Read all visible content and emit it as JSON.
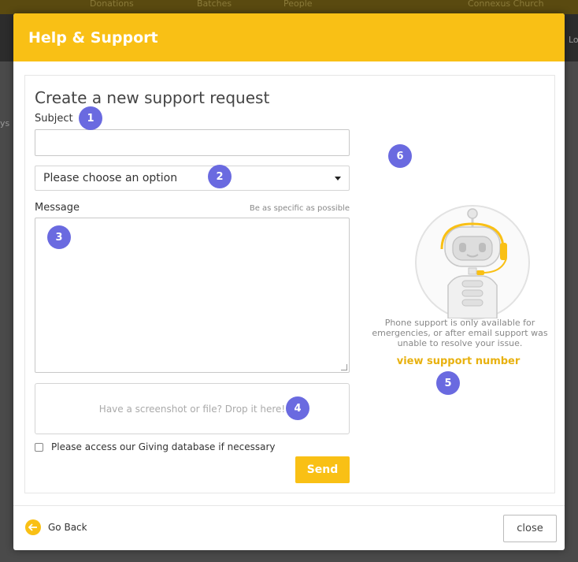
{
  "background": {
    "tabs": [
      "Donations",
      "Batches",
      "People"
    ],
    "account_text": "Connexus Church",
    "side_text_right": "Lo",
    "side_text_left": "ys"
  },
  "modal": {
    "title": "Help & Support"
  },
  "form": {
    "heading": "Create a new support request",
    "subject_label": "Subject",
    "subject_value": "",
    "select_value": "Please choose an option",
    "message_label": "Message",
    "message_hint": "Be as specific as possible",
    "message_value": "",
    "dropzone_text": "Have a screenshot or file? Drop it here!",
    "checkbox_label": "Please access our Giving database if necessary",
    "send_label": "Send"
  },
  "support": {
    "phone_note": "Phone support is only available for emergencies, or after email support was unable to resolve your issue.",
    "link_label": "view support number"
  },
  "badges": [
    "1",
    "2",
    "3",
    "4",
    "5",
    "6"
  ],
  "footer": {
    "back_label": "Go Back",
    "close_label": "close"
  },
  "colors": {
    "accent": "#f9c015",
    "badge": "#6a6ae0"
  }
}
